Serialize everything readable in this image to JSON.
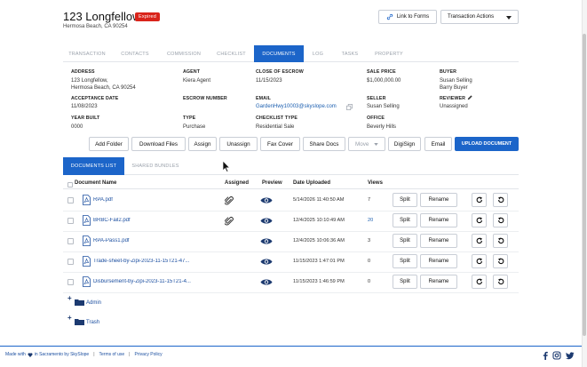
{
  "header": {
    "title": "123 Longfellow",
    "status_badge": "Expired",
    "subtitle": "Hermosa Beach, CA 90254",
    "link_forms_label": "Link to Forms",
    "transaction_actions_label": "Transaction Actions"
  },
  "tabs": [
    "TRANSACTION",
    "CONTACTS",
    "COMMISSION",
    "CHECKLIST",
    "DOCUMENTS",
    "LOG",
    "TASKS",
    "PROPERTY"
  ],
  "active_tab": "DOCUMENTS",
  "details": {
    "address_label": "ADDRESS",
    "address_line1": "123 Longfellow,",
    "address_line2": "Hermosa Beach, CA 90254",
    "agent_label": "AGENT",
    "agent": "Kiera Agent",
    "close_label": "CLOSE OF ESCROW",
    "close": "11/15/2023",
    "price_label": "SALE PRICE",
    "price": "$1,000,000.00",
    "buyer_label": "BUYER",
    "buyer1": "Susan Selling",
    "buyer2": "Barry Buyer",
    "acceptance_label": "ACCEPTANCE DATE",
    "acceptance": "11/08/2023",
    "escrow_label": "ESCROW NUMBER",
    "email_label": "EMAIL",
    "email": "GardenHwy10003@skyslope.com",
    "seller_label": "SELLER",
    "seller": "Susan Selling",
    "reviewer_label": "REVIEWER",
    "reviewer": "Unassigned",
    "year_label": "YEAR BUILT",
    "year": "0000",
    "type_label": "TYPE",
    "type": "Purchase",
    "checklist_label": "CHECKLIST TYPE",
    "checklist": "Residential Sale",
    "office_label": "OFFICE",
    "office": "Beverly Hills"
  },
  "toolbar": {
    "add_folder": "Add Folder",
    "download": "Download Files",
    "assign": "Assign",
    "unassign": "Unassign",
    "fax": "Fax Cover",
    "share": "Share Docs",
    "move": "Move",
    "digisign": "DigiSign",
    "email": "Email",
    "upload": "UPLOAD DOCUMENT"
  },
  "subtabs": {
    "documents_list": "DOCUMENTS LIST",
    "shared_bundles": "SHARED BUNDLES"
  },
  "table": {
    "headers": {
      "name": "Document Name",
      "assigned": "Assigned",
      "preview": "Preview",
      "date": "Date Uploaded",
      "views": "Views"
    },
    "split_label": "Split",
    "rename_label": "Rename",
    "rows": [
      {
        "name": "RPA.pdf",
        "assigned": true,
        "preview": true,
        "date": "5/14/2026 11:40:50 AM",
        "views": "7",
        "views_link": false
      },
      {
        "name": "BRBC-Fail2.pdf",
        "assigned": true,
        "preview": true,
        "date": "12/4/2025 10:10:49 AM",
        "views": "20",
        "views_link": true
      },
      {
        "name": "RPA-Pass1.pdf",
        "assigned": false,
        "preview": true,
        "date": "12/4/2025 10:06:36 AM",
        "views": "3",
        "views_link": false
      },
      {
        "name": "Trade-sheet-by-Zipi-2023-11-15T21-47...",
        "assigned": false,
        "preview": true,
        "date": "11/15/2023 1:47:01 PM",
        "views": "0",
        "views_link": false
      },
      {
        "name": "Disbursement-by-Zipi-2023-11-15T21-4...",
        "assigned": false,
        "preview": true,
        "date": "11/15/2023 1:46:59 PM",
        "views": "0",
        "views_link": false
      }
    ]
  },
  "folders": [
    "Admin",
    "Trash"
  ],
  "footer": {
    "made_prefix": "Made with",
    "made_suffix": "in Sacramento by SkySlope",
    "terms": "Terms of use",
    "privacy": "Privacy Policy"
  },
  "icons": {
    "link_forms": "link-icon",
    "dropdown": "caret-down-icon",
    "reviewer_edit": "pencil-icon",
    "email_copy": "copy-icon",
    "file": "pdf-file-icon",
    "assigned": "paperclip-icon",
    "preview": "eye-icon",
    "redo": "redo-icon",
    "undo": "undo-icon",
    "folder": "folder-icon",
    "heart": "heart-icon",
    "facebook": "facebook-icon",
    "instagram": "instagram-icon",
    "twitter": "twitter-icon"
  },
  "colors": {
    "primary": "#1c65c9",
    "badge": "#d9241b",
    "link": "#1c4fa0"
  }
}
